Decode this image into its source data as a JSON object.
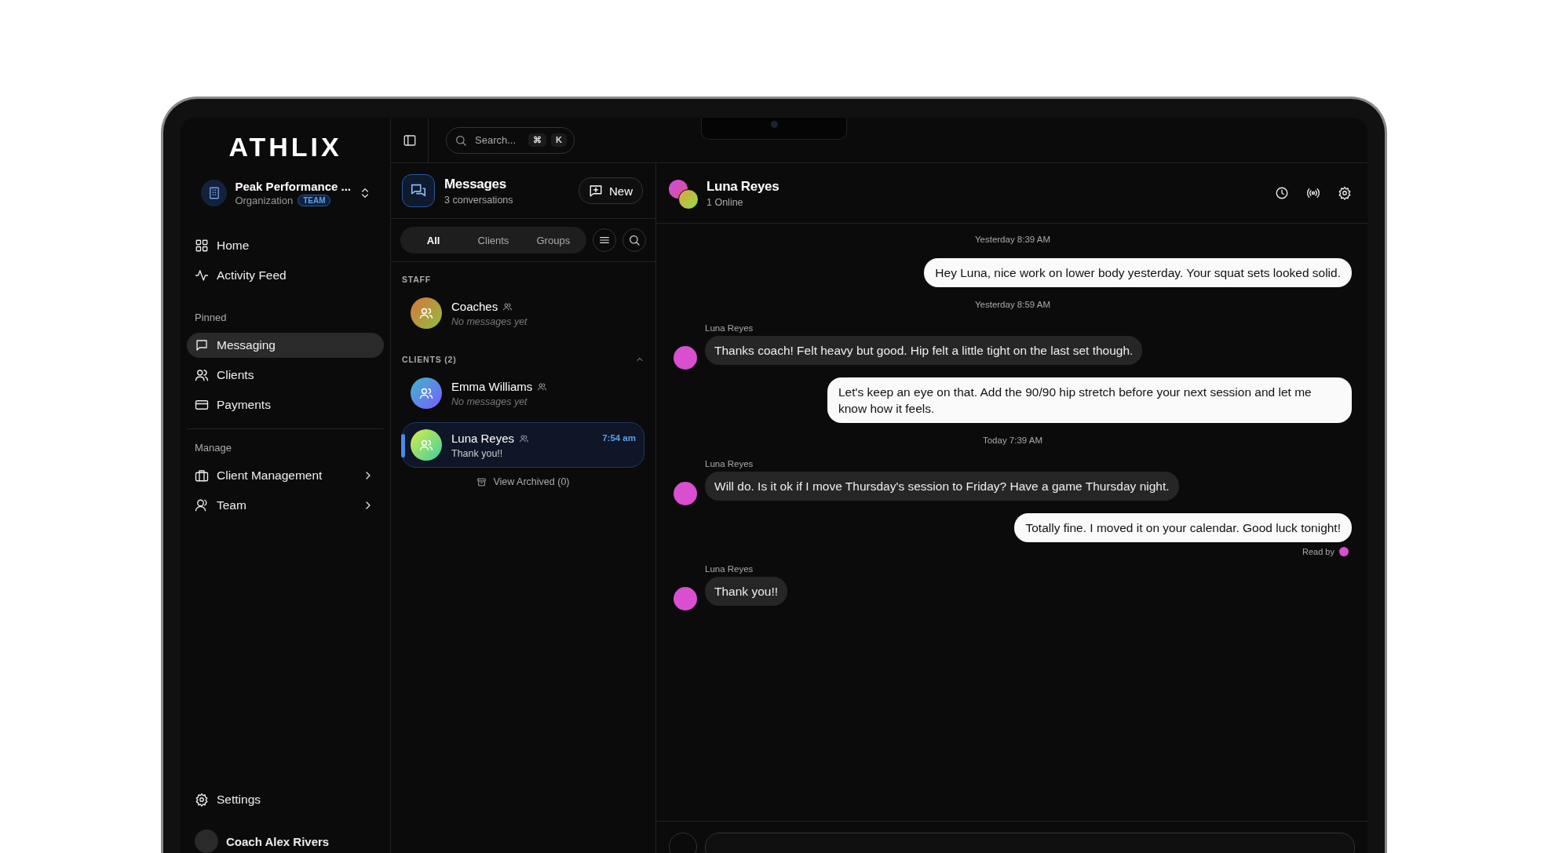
{
  "brand": {
    "logo": "ATHLIX"
  },
  "organization": {
    "name": "Peak Performance ...",
    "type": "Organization",
    "badge": "TEAM"
  },
  "nav_groups": [
    {
      "items": [
        {
          "label": "Home",
          "kind": "link",
          "selected": false
        },
        {
          "label": "Activity Feed",
          "kind": "link",
          "selected": false
        }
      ]
    },
    {
      "heading": "Pinned",
      "items": [
        {
          "label": "Messaging",
          "kind": "link",
          "selected": true
        },
        {
          "label": "Clients",
          "kind": "link",
          "selected": false
        },
        {
          "label": "Payments",
          "kind": "link",
          "selected": false
        }
      ]
    },
    {
      "heading": "Manage",
      "items": [
        {
          "label": "Client Management",
          "kind": "submenu",
          "selected": false
        },
        {
          "label": "Team",
          "kind": "submenu",
          "selected": false
        }
      ]
    }
  ],
  "settings": {
    "label": "Settings"
  },
  "user": {
    "name": "Coach Alex Rivers"
  },
  "topbar": {
    "search": {
      "placeholder": "Search...",
      "shortcut": [
        "⌘",
        "K"
      ]
    }
  },
  "conversations_panel": {
    "title": "Messages",
    "subtitle": "3 conversations",
    "new_button": "New",
    "filters": [
      {
        "label": "All",
        "selected": true
      },
      {
        "label": "Clients",
        "selected": false
      },
      {
        "label": "Groups",
        "selected": false
      }
    ],
    "sections": [
      {
        "heading": "STAFF",
        "items": [
          {
            "name": "Coaches",
            "preview": "No messages yet",
            "has_messages": false,
            "selected": false
          }
        ]
      },
      {
        "heading": "CLIENTS (2)",
        "items": [
          {
            "name": "Emma Williams",
            "preview": "No messages yet",
            "has_messages": false,
            "selected": false
          },
          {
            "name": "Luna Reyes",
            "preview": "Thank you!!",
            "time": "7:54 am",
            "has_messages": true,
            "selected": true
          }
        ]
      }
    ],
    "archived": "View Archived (0)"
  },
  "chat": {
    "name": "Luna Reyes",
    "status": "1 Online",
    "messages": [
      {
        "kind": "timestamp",
        "text": "Yesterday 8:39 AM"
      },
      {
        "kind": "outgoing",
        "text": "Hey Luna, nice work on lower body yesterday. Your squat sets looked solid."
      },
      {
        "kind": "timestamp",
        "text": "Yesterday 8:59 AM"
      },
      {
        "kind": "incoming",
        "sender": "Luna Reyes",
        "text": "Thanks coach! Felt heavy but good. Hip felt a little tight on the last set though.",
        "color": "#d94fd0"
      },
      {
        "kind": "outgoing",
        "text": "Let's keep an eye on that. Add the 90/90 hip stretch before your next session and let me know how it feels."
      },
      {
        "kind": "timestamp",
        "text": "Today 7:39 AM"
      },
      {
        "kind": "incoming",
        "sender": "Luna Reyes",
        "text": "Will do. Is it ok if I move Thursday's session to Friday? Have a game Thursday night.",
        "color": "#d94fd0"
      },
      {
        "kind": "outgoing",
        "text": "Totally fine. I moved it on your calendar. Good luck tonight!"
      },
      {
        "kind": "receipt",
        "text": "Read by",
        "color": "#d94fd0"
      },
      {
        "kind": "incoming",
        "sender": "Luna Reyes",
        "text": "Thank you!!",
        "color": "#d94fd0"
      }
    ]
  }
}
